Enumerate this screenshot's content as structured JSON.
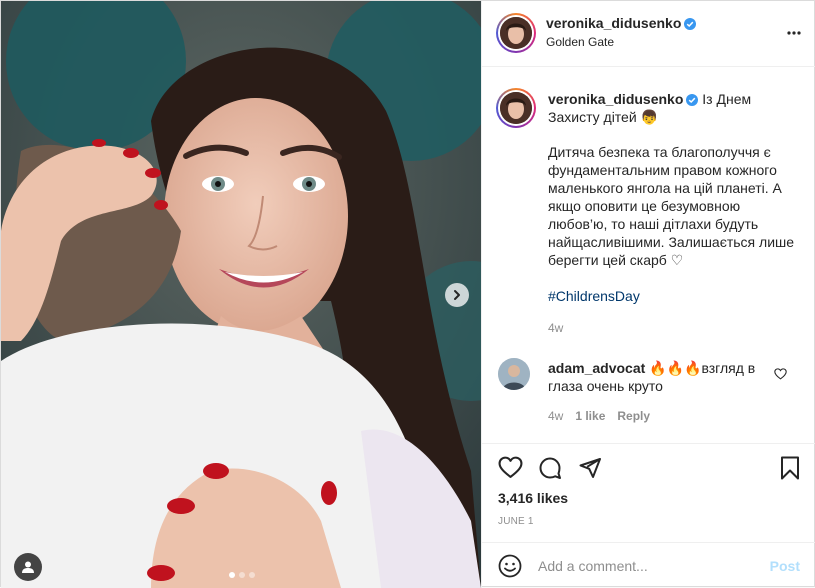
{
  "post": {
    "username": "veronika_didusenko",
    "location": "Golden Gate",
    "photo_count": 3,
    "active_photo": 1
  },
  "caption": {
    "title": "Із Днем Захисту дітей 👦",
    "body": "Дитяча безпека та благополуччя є фундаментальним правом кожного маленького янгола на цій планеті. А якщо оповити це безумовною любов’ю, то наші дітлахи будуть найщасливішими. Залишається лише берегти цей скарб ♡",
    "hashtag": "#ChildrensDay",
    "age": "4w"
  },
  "comment": {
    "username": "adam_advocat",
    "text": "🔥🔥🔥взгляд в глаза очень круто",
    "age": "4w",
    "likes": "1 like",
    "reply_label": "Reply"
  },
  "footer": {
    "likes": "3,416 likes",
    "date": "JUNE 1",
    "comment_placeholder": "Add a comment...",
    "post_label": "Post"
  },
  "icons": {
    "verified": "verified-badge-icon",
    "more": "more-options-icon",
    "like": "heart-icon",
    "comment": "comment-bubble-icon",
    "share": "paper-plane-icon",
    "save": "bookmark-icon",
    "emoji": "emoji-smile-icon",
    "next": "chevron-right-icon",
    "tag": "user-tag-icon"
  },
  "colors": {
    "verified_blue": "#3897f0",
    "hashtag": "#00376b",
    "post_disabled": "#b2dffc",
    "secondary_text": "#8e8e8e"
  }
}
